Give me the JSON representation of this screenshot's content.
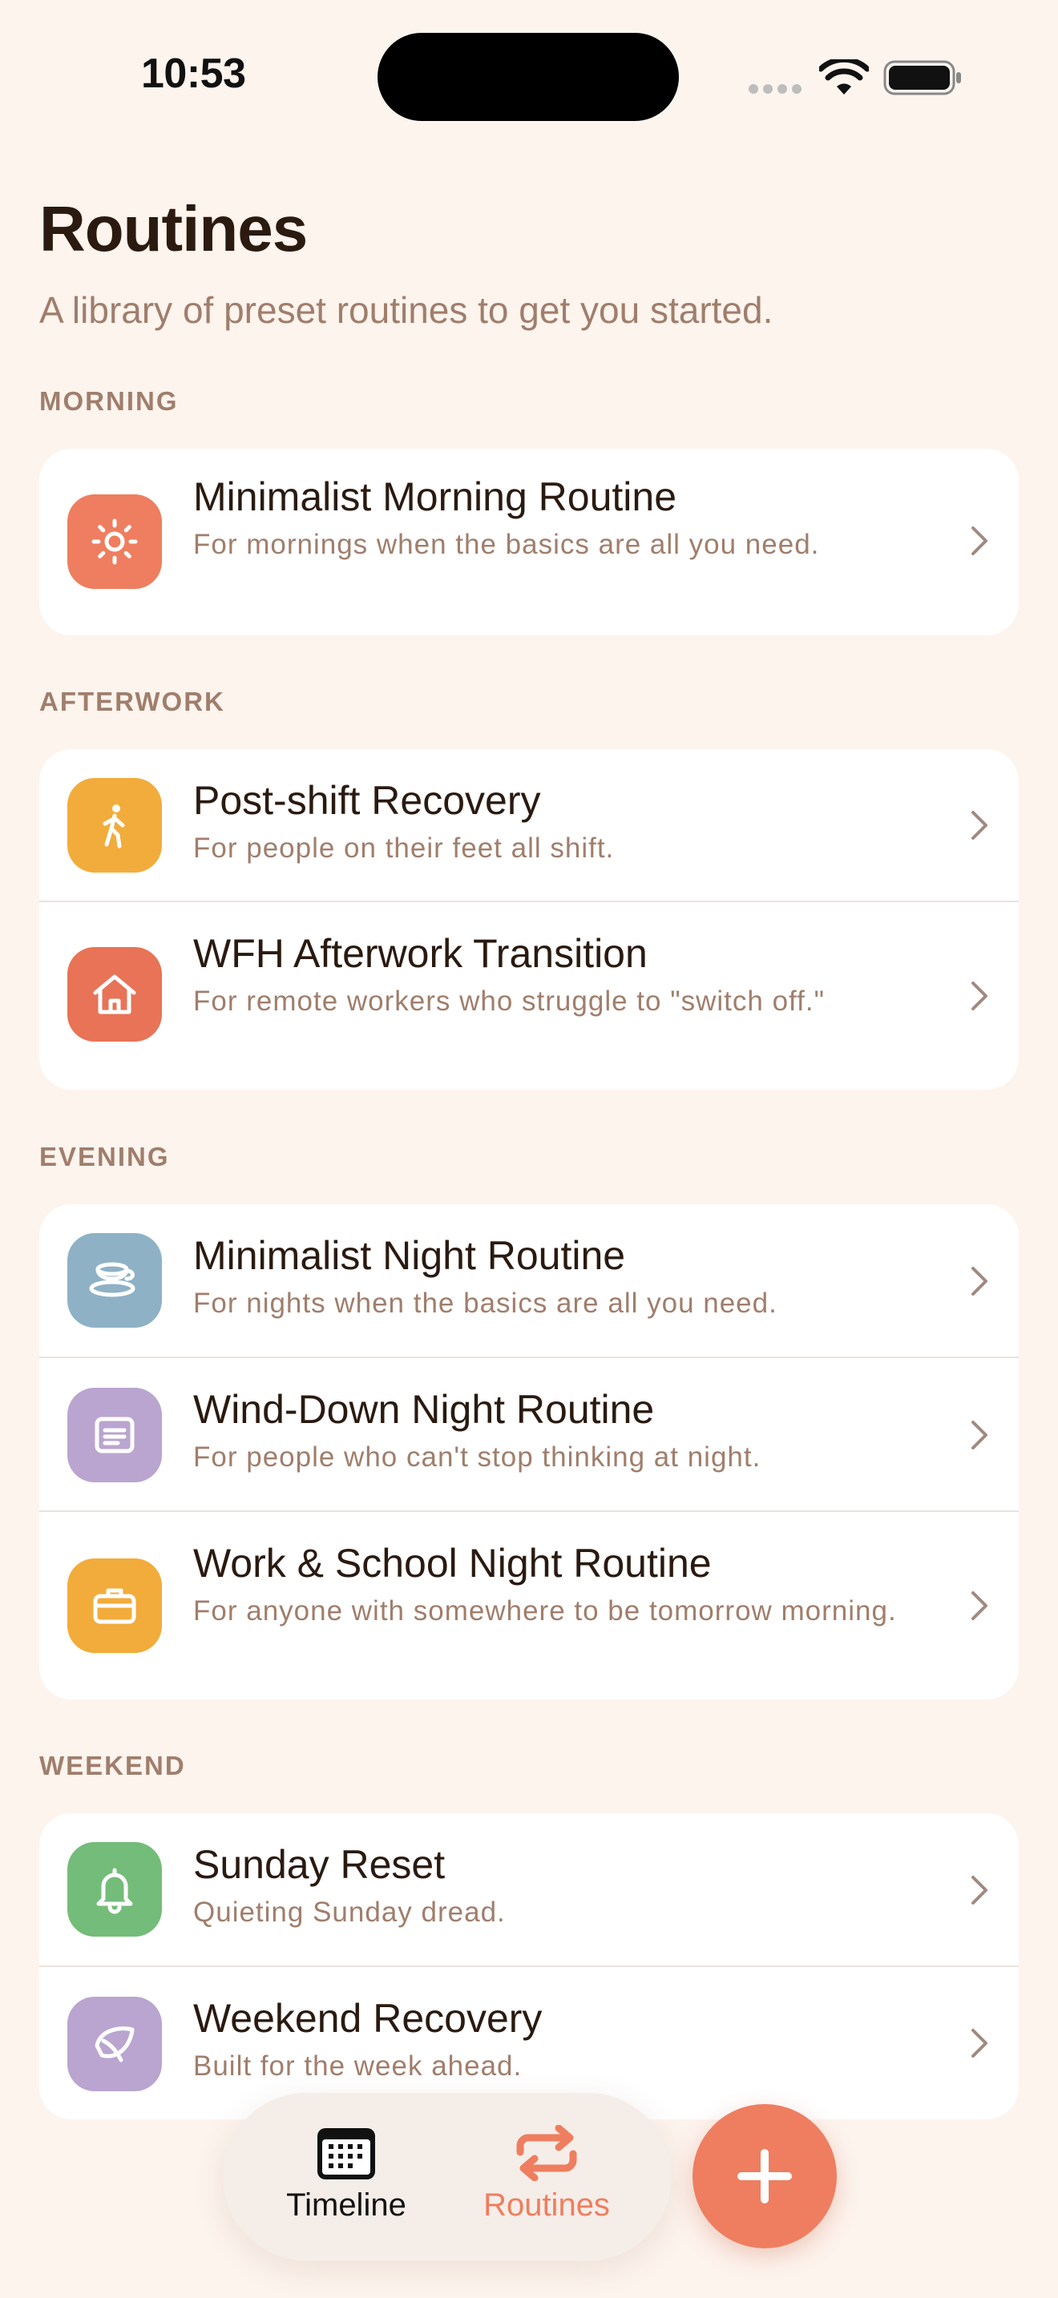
{
  "status_bar": {
    "time": "10:53"
  },
  "header": {
    "title": "Routines",
    "subtitle": "A library of preset routines to get you started."
  },
  "sections": [
    {
      "label": "MORNING",
      "items": [
        {
          "title": "Minimalist Morning Routine",
          "description": "For mornings when the basics are all you need.",
          "icon": "sun-icon",
          "color": "#EE7E5F"
        }
      ]
    },
    {
      "label": "AFTERWORK",
      "items": [
        {
          "title": "Post-shift Recovery",
          "description": "For people on their feet all shift.",
          "icon": "walking-person-icon",
          "color": "#F2AC3B"
        },
        {
          "title": "WFH Afterwork Transition",
          "description": "For remote workers who struggle to \"switch off.\"",
          "icon": "house-icon",
          "color": "#E87356"
        }
      ]
    },
    {
      "label": "EVENING",
      "items": [
        {
          "title": "Minimalist Night Routine",
          "description": "For nights when the basics are all you need.",
          "icon": "teacup-icon",
          "color": "#8EB1C6"
        },
        {
          "title": "Wind-Down Night Routine",
          "description": "For people who can't stop thinking at night.",
          "icon": "notepad-icon",
          "color": "#B9A5CF"
        },
        {
          "title": "Work & School Night Routine",
          "description": "For anyone with somewhere to be tomorrow morning.",
          "icon": "briefcase-icon",
          "color": "#F2AC3B"
        }
      ]
    },
    {
      "label": "WEEKEND",
      "items": [
        {
          "title": "Sunday Reset",
          "description": "Quieting Sunday dread.",
          "icon": "bell-icon",
          "color": "#74BC7A"
        },
        {
          "title": "Weekend Recovery",
          "description": "Built for the week ahead.",
          "icon": "leaf-icon",
          "color": "#B9A5CF"
        }
      ]
    }
  ],
  "tab_bar": {
    "tabs": [
      {
        "label": "Timeline",
        "icon": "calendar-icon",
        "active": false
      },
      {
        "label": "Routines",
        "icon": "repeat-icon",
        "active": true
      }
    ],
    "active_color": "#EE7E5F",
    "add_button_icon": "plus-icon"
  }
}
